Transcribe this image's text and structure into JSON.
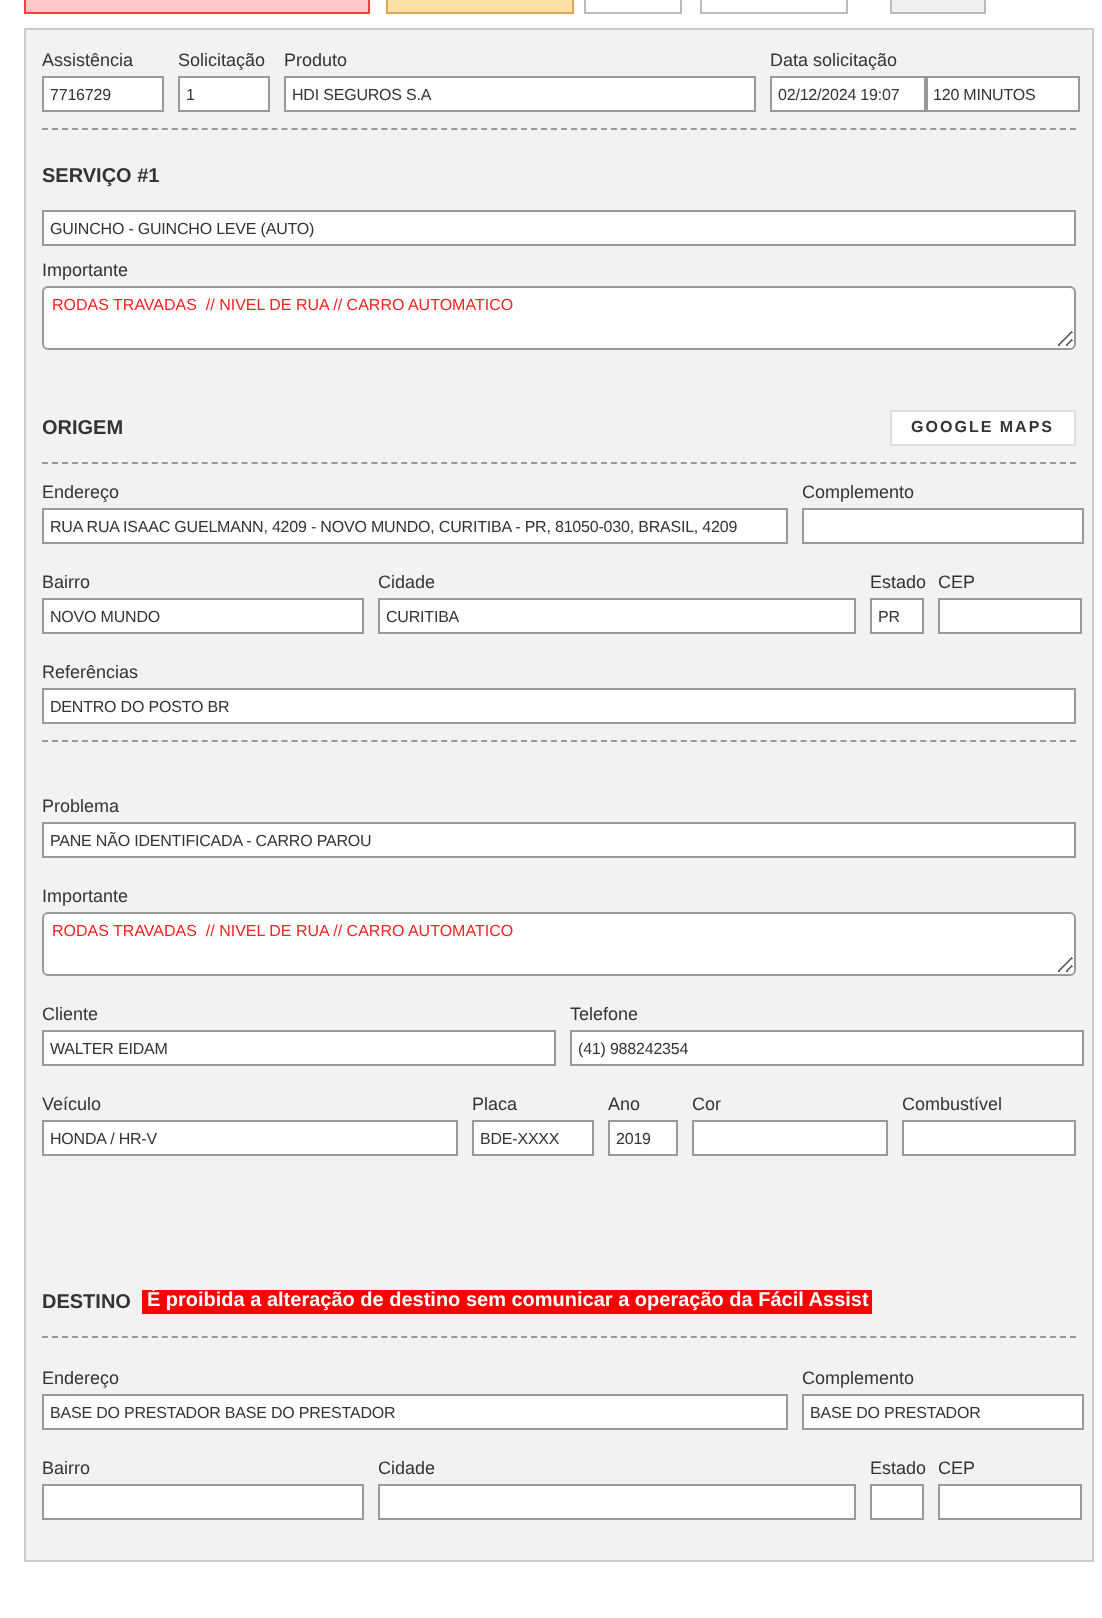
{
  "toolbar": [
    {
      "kind": "danger"
    },
    {
      "kind": "warning"
    },
    {
      "kind": "photos"
    },
    {
      "kind": "folder"
    },
    {
      "kind": "plain"
    }
  ],
  "sections": [
    {
      "kind": "header",
      "rows": [
        {
          "fields": [
            {
              "label": "Assistência",
              "values": [
                "7716729"
              ]
            },
            {
              "label": "Solicitação",
              "values": [
                "1"
              ]
            },
            {
              "label": "Produto",
              "values": [
                "HDI SEGUROS S.A"
              ]
            },
            {
              "label": "Data solicitação",
              "values": [
                "02/12/2024 19:07",
                "120 MINUTOS"
              ]
            }
          ]
        }
      ]
    },
    {
      "kind": "service",
      "title": "SERVIÇO #1",
      "rows": [
        {
          "fields": [
            {
              "values": [
                "GUINCHO - GUINCHO LEVE (AUTO)"
              ]
            }
          ]
        },
        {
          "fields": [
            {
              "label": "Importante",
              "kind": "textarea",
              "values": [
                "RODAS TRAVADAS  // NIVEL DE RUA // CARRO AUTOMATICO"
              ]
            }
          ]
        }
      ]
    },
    {
      "kind": "origin",
      "title": "ORIGEM",
      "button": "GOOGLE MAPS",
      "rows": [
        {
          "fields": [
            {
              "label": "Endereço",
              "values": [
                "RUA RUA ISAAC GUELMANN, 4209 - NOVO MUNDO, CURITIBA - PR, 81050-030, BRASIL, 4209"
              ]
            },
            {
              "label": "Complemento"
            }
          ]
        },
        {
          "fields": [
            {
              "label": "Bairro",
              "values": [
                "NOVO MUNDO"
              ]
            },
            {
              "label": "Cidade",
              "values": [
                "CURITIBA"
              ]
            },
            {
              "label": "Estado",
              "values": [
                "PR"
              ]
            },
            {
              "label": "CEP"
            }
          ]
        },
        {
          "fields": [
            {
              "label": "Referências",
              "values": [
                "DENTRO DO POSTO BR"
              ]
            }
          ]
        }
      ]
    },
    {
      "kind": "details",
      "rows": [
        {
          "fields": [
            {
              "label": "Problema",
              "values": [
                "PANE NÃO IDENTIFICADA - CARRO PAROU"
              ]
            }
          ]
        },
        {
          "fields": [
            {
              "label": "Importante",
              "kind": "textarea",
              "values": [
                "RODAS TRAVADAS  // NIVEL DE RUA // CARRO AUTOMATICO"
              ]
            }
          ]
        },
        {
          "fields": [
            {
              "label": "Cliente",
              "values": [
                "WALTER EIDAM"
              ]
            },
            {
              "label": "Telefone",
              "values": [
                "(41) 988242354"
              ]
            }
          ]
        },
        {
          "fields": [
            {
              "label": "Veículo",
              "values": [
                "HONDA / HR-V"
              ]
            },
            {
              "label": "Placa",
              "values": [
                "BDE-XXXX"
              ]
            },
            {
              "label": "Ano",
              "values": [
                "2019"
              ]
            },
            {
              "label": "Cor"
            },
            {
              "label": "Combustível"
            }
          ]
        }
      ]
    },
    {
      "kind": "destination",
      "title": "DESTINO",
      "warning": "É proibida a alteração de destino sem comunicar a operação da Fácil Assist",
      "rows": [
        {
          "fields": [
            {
              "label": "Endereço",
              "values": [
                "BASE DO PRESTADOR BASE DO PRESTADOR"
              ]
            },
            {
              "label": "Complemento",
              "values": [
                "BASE DO PRESTADOR"
              ]
            }
          ]
        },
        {
          "fields": [
            {
              "label": "Bairro"
            },
            {
              "label": "Cidade"
            },
            {
              "label": "Estado"
            },
            {
              "label": "CEP"
            }
          ]
        }
      ]
    }
  ]
}
